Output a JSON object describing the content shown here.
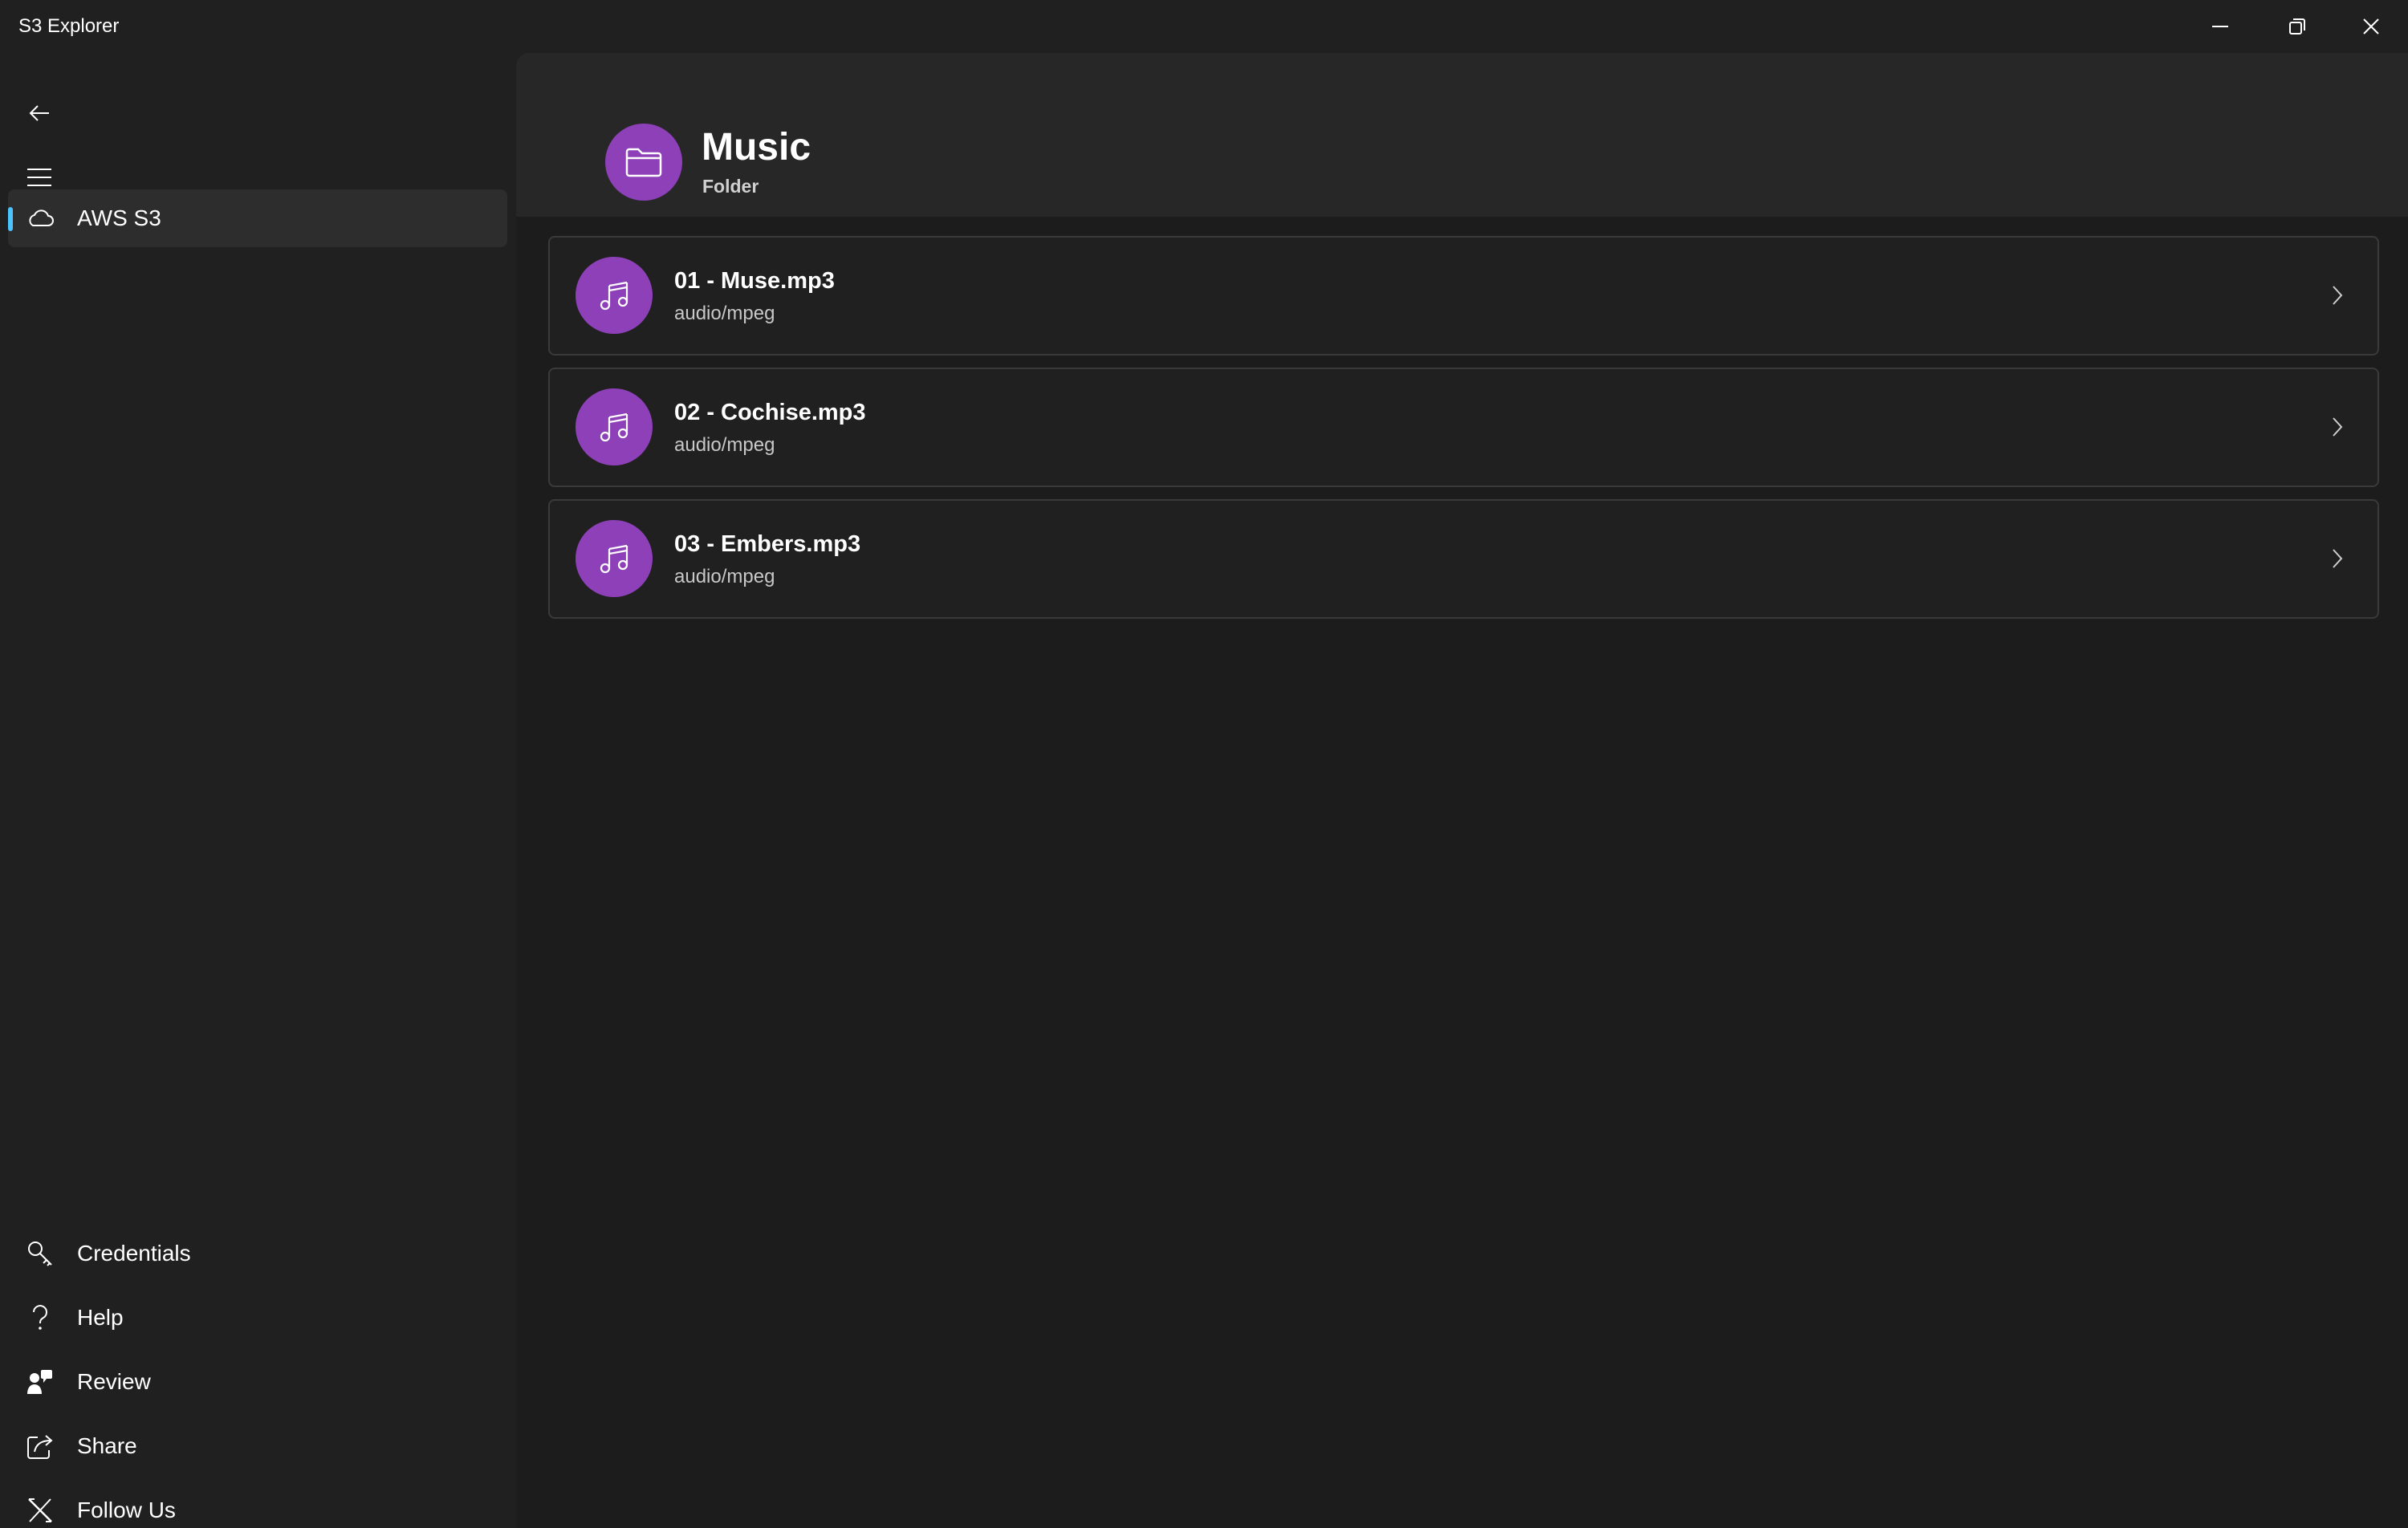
{
  "window": {
    "title": "S3 Explorer",
    "controls": [
      "minimize",
      "restore",
      "close"
    ]
  },
  "sidebar": {
    "top_buttons": [
      {
        "name": "back-arrow-icon"
      },
      {
        "name": "hamburger-menu-icon"
      }
    ],
    "items": [
      {
        "label": "AWS S3",
        "icon": "cloud-icon",
        "selected": true
      }
    ],
    "footer_items": [
      {
        "label": "Credentials",
        "icon": "key-icon"
      },
      {
        "label": "Help",
        "icon": "question-icon"
      },
      {
        "label": "Review",
        "icon": "person-feedback-icon"
      },
      {
        "label": "Share",
        "icon": "share-icon"
      },
      {
        "label": "Follow Us",
        "icon": "x-logo-icon"
      }
    ]
  },
  "header": {
    "icon": "folder-icon",
    "title": "Music",
    "subtitle": "Folder"
  },
  "files": [
    {
      "name": "01 - Muse.mp3",
      "type": "audio/mpeg",
      "icon": "music-note-icon"
    },
    {
      "name": "02 - Cochise.mp3",
      "type": "audio/mpeg",
      "icon": "music-note-icon"
    },
    {
      "name": "03 - Embers.mp3",
      "type": "audio/mpeg",
      "icon": "music-note-icon"
    }
  ],
  "colors": {
    "accent": "#4cc2ff",
    "icon_circle": "#8d40b8",
    "background": "#202020",
    "content_background": "#1c1c1c"
  }
}
